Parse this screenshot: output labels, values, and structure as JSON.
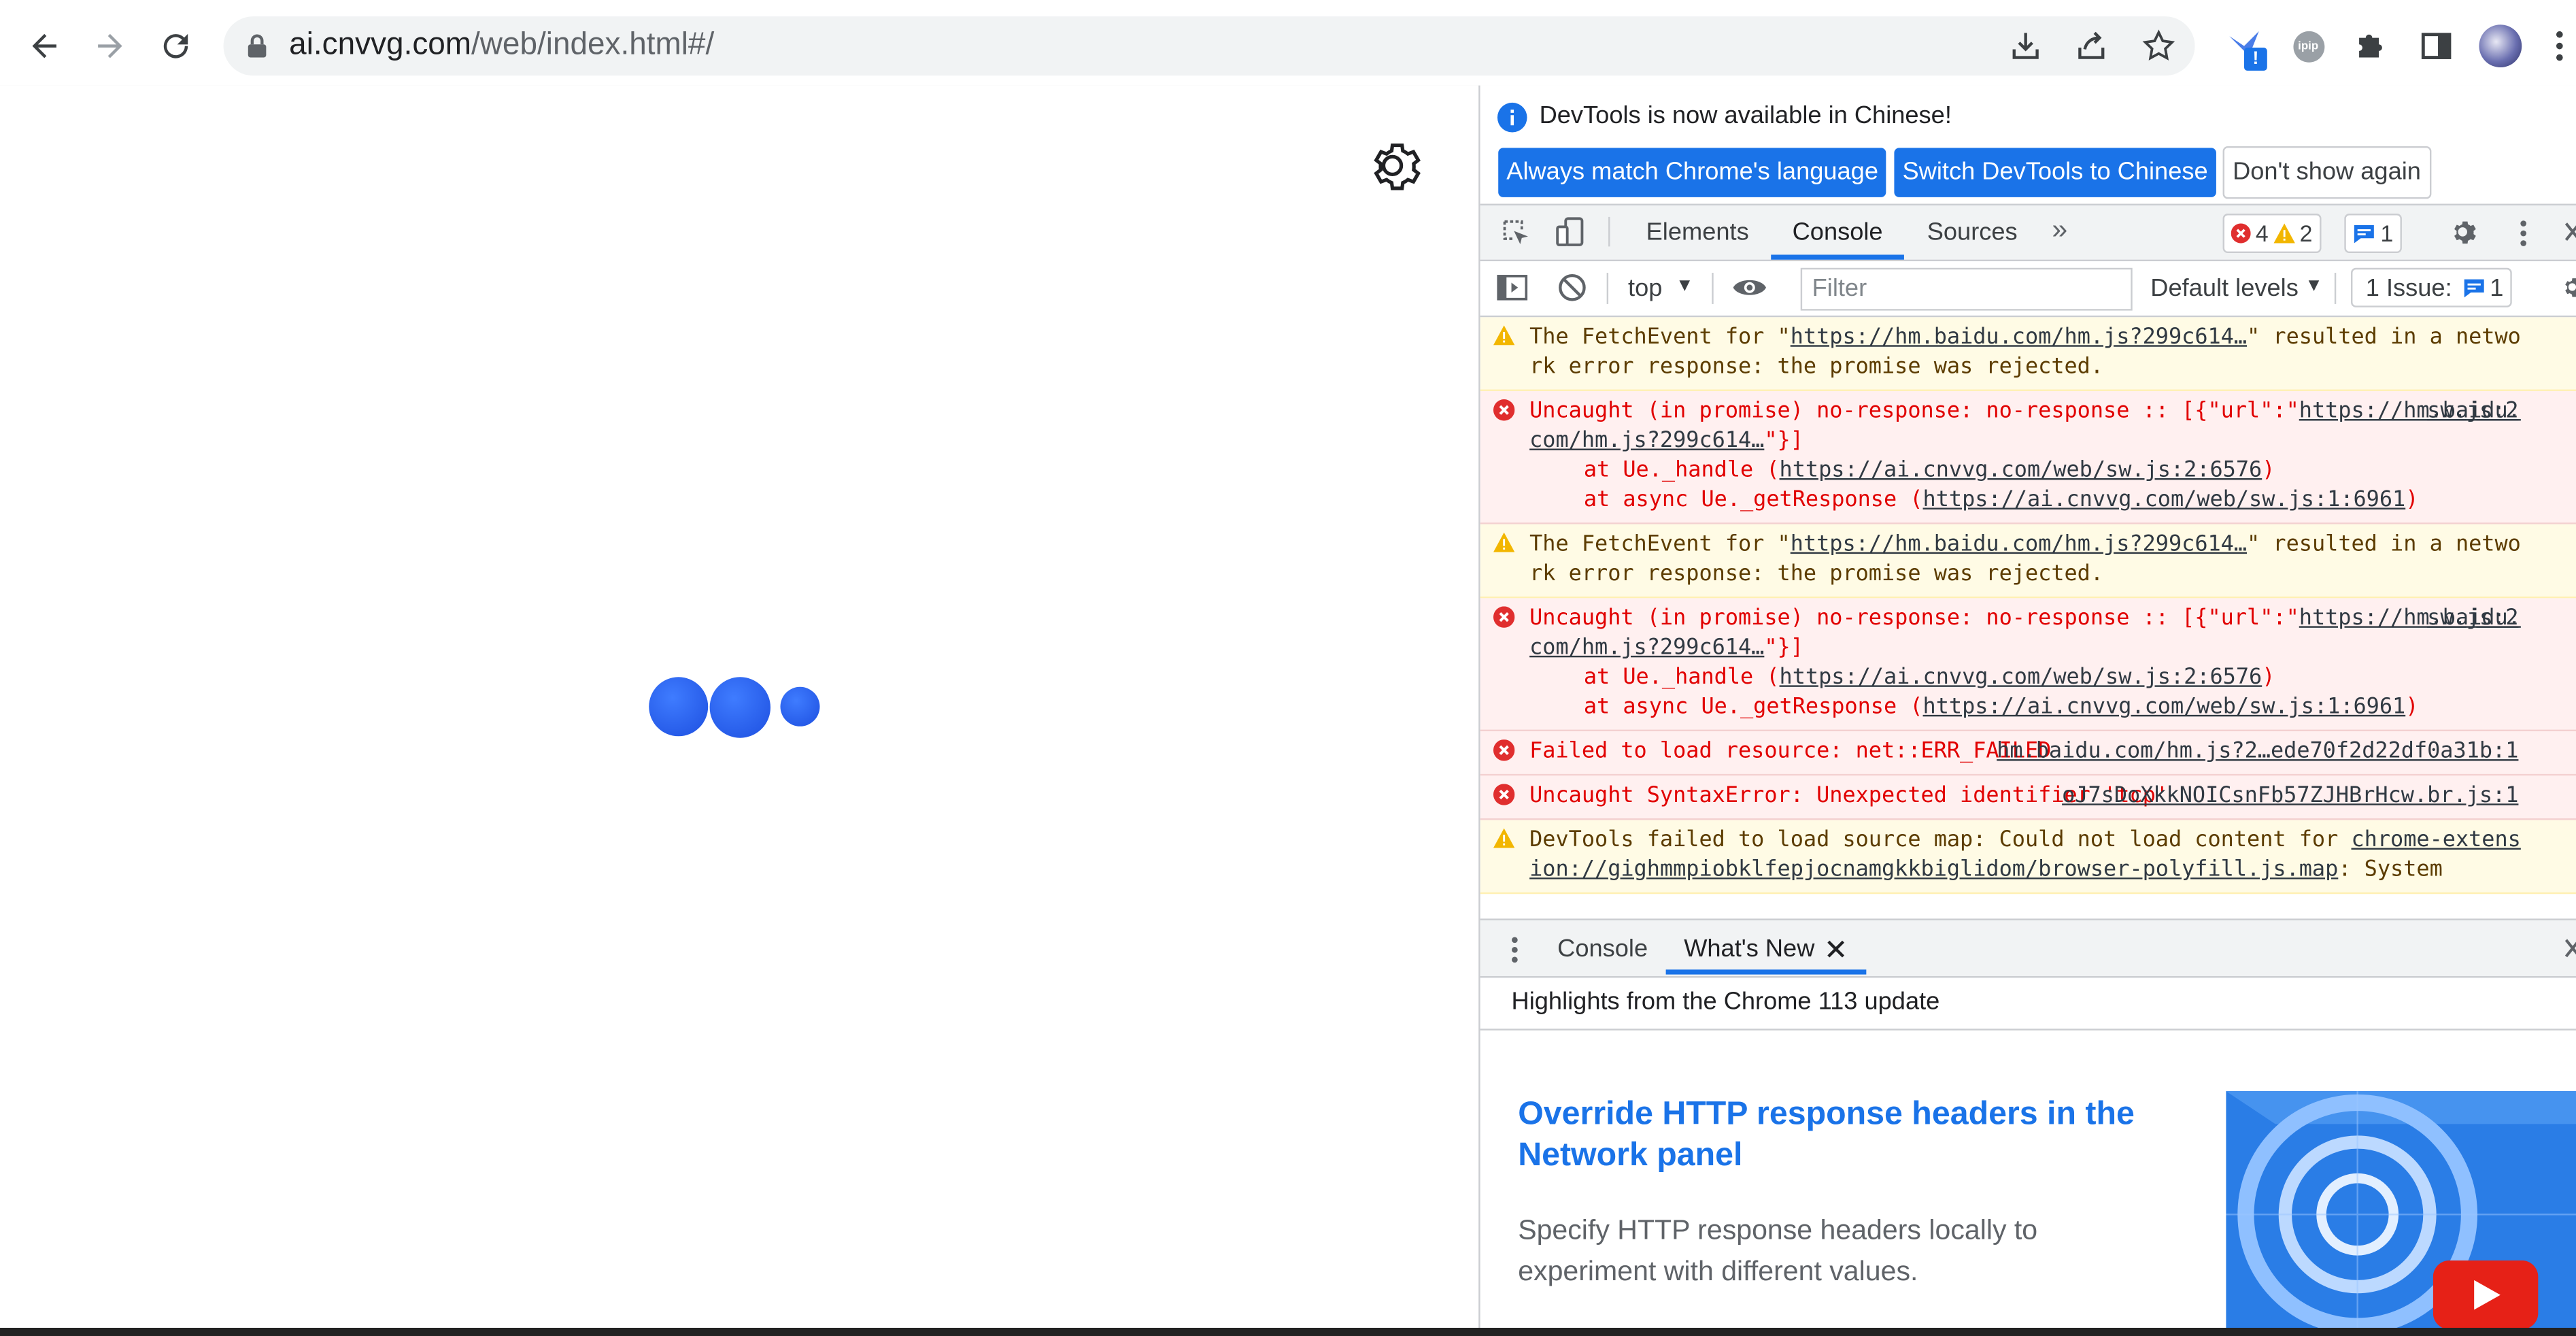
{
  "browser": {
    "url_host": "ai.cnvvg.com",
    "url_path": "/web/index.html#/",
    "ext_badge": "!",
    "ext_label": "ipip"
  },
  "devtools": {
    "info_message": "DevTools is now available in Chinese!",
    "info_buttons": [
      "Always match Chrome's language",
      "Switch DevTools to Chinese",
      "Don't show again"
    ],
    "tabs": [
      "Elements",
      "Console",
      "Sources"
    ],
    "active_tab": "Console",
    "error_count": "4",
    "warning_count": "2",
    "issue_count": "1",
    "context": "top",
    "filter_placeholder": "Filter",
    "levels": "Default levels",
    "issues_label": "1 Issue:",
    "issues_count": "1",
    "messages": [
      {
        "type": "warn",
        "pre": "The FetchEvent for \"",
        "link": "https://hm.baidu.com/hm.js?299c614…",
        "post": "\" resulted in a network error response: the promise was rejected.",
        "source": ""
      },
      {
        "type": "err",
        "pre": "Uncaught (in promise) no-response: no-response :: [{\"url\":\"",
        "link": "https://hm.baidu.com/hm.js?299c614…",
        "post": "\"}]",
        "source": "sw.js:2",
        "stack": [
          {
            "pre": "at Ue._handle (",
            "link": "https://ai.cnvvg.com/web/sw.js:2:6576",
            "post": ")"
          },
          {
            "pre": "at async Ue._getResponse (",
            "link": "https://ai.cnvvg.com/web/sw.js:1:6961",
            "post": ")"
          }
        ]
      },
      {
        "type": "warn",
        "pre": "The FetchEvent for \"",
        "link": "https://hm.baidu.com/hm.js?299c614…",
        "post": "\" resulted in a network error response: the promise was rejected.",
        "source": ""
      },
      {
        "type": "err",
        "pre": "Uncaught (in promise) no-response: no-response :: [{\"url\":\"",
        "link": "https://hm.baidu.com/hm.js?299c614…",
        "post": "\"}]",
        "source": "sw.js:2",
        "stack": [
          {
            "pre": "at Ue._handle (",
            "link": "https://ai.cnvvg.com/web/sw.js:2:6576",
            "post": ")"
          },
          {
            "pre": "at async Ue._getResponse (",
            "link": "https://ai.cnvvg.com/web/sw.js:1:6961",
            "post": ")"
          }
        ]
      },
      {
        "type": "err",
        "pre": "Failed to load resource: net::ERR_FAILED",
        "link": "",
        "post": "",
        "source": "hm.baidu.com/hm.js?2…ede70f2d22df0a31b:1"
      },
      {
        "type": "err",
        "pre": "Uncaught SyntaxError: Unexpected identifier 'tcp'",
        "link": "",
        "post": "",
        "source": "oJ7sDoXkkNOICsnFb57ZJHBrHcw.br.js:1"
      },
      {
        "type": "warn",
        "pre": "DevTools failed to load source map: Could not load content for ",
        "link": "chrome-extension://gighmmpiobklfepjocnamgkkbiglidom/browser-polyfill.js.map",
        "post": ": System",
        "source": ""
      }
    ],
    "drawer_tabs": [
      "Console",
      "What's New"
    ],
    "drawer_heading": "Highlights from the Chrome 113 update",
    "whats_new_title": "Override HTTP response headers in the Network panel",
    "whats_new_desc": "Specify HTTP response headers locally to experiment with different values."
  }
}
